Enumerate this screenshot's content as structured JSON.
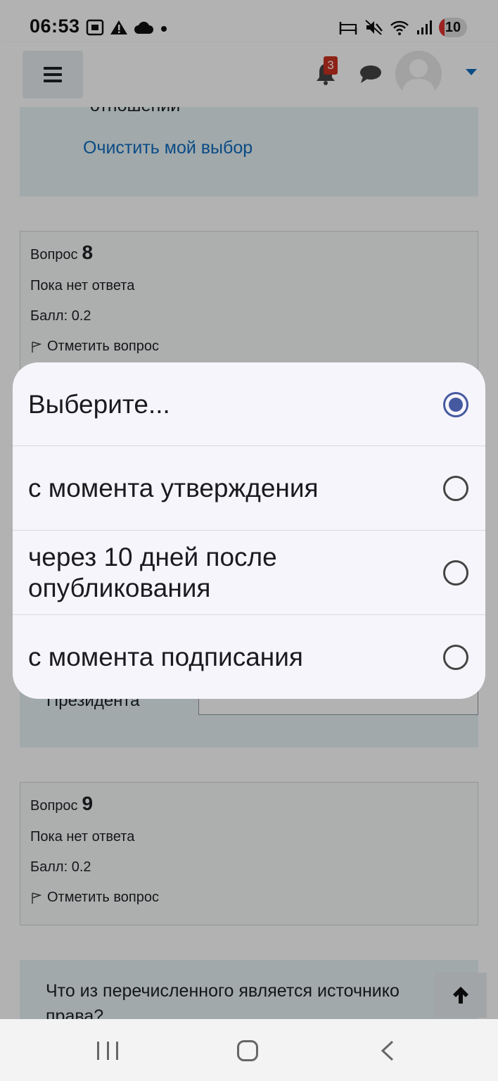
{
  "status_bar": {
    "time": "06:53",
    "left_icons": [
      "screenshot-icon",
      "warning-icon",
      "cloud-icon",
      "dot-icon"
    ],
    "right_icons": [
      "bed-icon",
      "mute-icon",
      "wifi-icon",
      "signal-icon"
    ],
    "battery": "10"
  },
  "navbar": {
    "menu_icon": "hamburger-icon",
    "notifications_count": "3",
    "icons": [
      "bell-icon",
      "chat-icon",
      "avatar",
      "caret-down-icon"
    ]
  },
  "page": {
    "prev_answer_tail": "отношении",
    "clear_choice": "Очистить мой выбор",
    "question8": {
      "label": "Вопрос",
      "number": "8",
      "status": "Пока нет ответа",
      "score": "Балл: 0.2",
      "flag": "Отметить вопрос"
    },
    "q8_dropdown_label": "Президента",
    "question9": {
      "label": "Вопрос",
      "number": "9",
      "status": "Пока нет ответа",
      "score": "Балл: 0.2",
      "flag": "Отметить вопрос"
    },
    "next_question_text": "Что из перечисленного является источнико права?"
  },
  "picker": {
    "options": [
      {
        "label": "Выберите...",
        "selected": true
      },
      {
        "label": "с момента утверждения",
        "selected": false
      },
      {
        "label": "через 10 дней после опубликования",
        "selected": false
      },
      {
        "label": "с момента подписания",
        "selected": false
      }
    ]
  },
  "colors": {
    "link": "#0f6cbf",
    "radio_selected": "#4559a0",
    "badge": "#ca3120",
    "question_bg": "#e7f3f5"
  }
}
